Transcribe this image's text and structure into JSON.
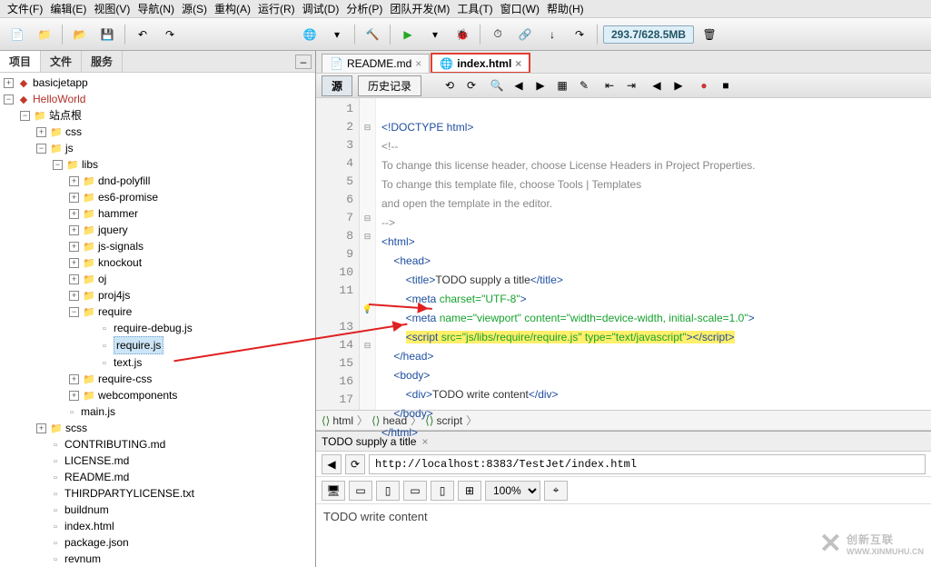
{
  "menu": [
    "文件(F)",
    "编辑(E)",
    "视图(V)",
    "导航(N)",
    "源(S)",
    "重构(A)",
    "运行(R)",
    "调试(D)",
    "分析(P)",
    "团队开发(M)",
    "工具(T)",
    "窗口(W)",
    "帮助(H)"
  ],
  "memory": "293.7/628.5MB",
  "leftTabs": {
    "project": "项目",
    "files": "文件",
    "services": "服务"
  },
  "tree": {
    "proj1": "basicjetapp",
    "proj2": "HelloWorld",
    "siteRoot": "站点根",
    "css": "css",
    "js": "js",
    "libs": "libs",
    "dnd": "dnd-polyfill",
    "es6": "es6-promise",
    "hammer": "hammer",
    "jquery": "jquery",
    "jssignals": "js-signals",
    "knockout": "knockout",
    "oj": "oj",
    "proj4js": "proj4js",
    "require": "require",
    "requiredebug": "require-debug.js",
    "requirejs": "require.js",
    "textjs": "text.js",
    "requirecss": "require-css",
    "webcomponents": "webcomponents",
    "mainjs": "main.js",
    "scss": "scss",
    "contributing": "CONTRIBUTING.md",
    "license": "LICENSE.md",
    "readme": "README.md",
    "thirdparty": "THIRDPARTYLICENSE.txt",
    "buildnum": "buildnum",
    "indexhtml": "index.html",
    "packagejson": "package.json",
    "revnum": "revnum"
  },
  "editorTabs": {
    "readme": "README.md",
    "index": "index.html"
  },
  "editorModes": {
    "source": "源",
    "history": "历史记录"
  },
  "code": {
    "l1": "<!DOCTYPE html>",
    "l2": "<!--",
    "l3": "To change this license header, choose License Headers in Project Properties.",
    "l4": "To change this template file, choose Tools | Templates",
    "l5": "and open the template in the editor.",
    "l6": "-->",
    "l7": "<html>",
    "l8": "    <head>",
    "l9a": "        <title>",
    "l9b": "TODO supply a title",
    "l9c": "</title>",
    "l10a": "        <meta ",
    "l10b": "charset=\"UTF-8\"",
    "l10c": ">",
    "l11a": "        <meta ",
    "l11b": "name=\"viewport\" content=\"width=device-width, initial-scale=1.0\"",
    "l11c": ">",
    "l12a": "        ",
    "l12b": "<script ",
    "l12c": "src=\"js/libs/require/require.js\" type=\"text/javascript\"",
    "l12d": ">",
    "l12e": "</",
    "l12f": "script>",
    "l13": "    </head>",
    "l14": "    <body>",
    "l15a": "        <div>",
    "l15b": "TODO write content",
    "l15c": "</div>",
    "l16": "    </body>",
    "l17": "</html>"
  },
  "breadcrumb": {
    "html": "html",
    "head": "head",
    "script": "script"
  },
  "preview": {
    "title": "TODO supply a title",
    "url": "http://localhost:8383/TestJet/index.html",
    "zoom": "100%",
    "body": "TODO write content"
  },
  "watermark": {
    "main": "创新互联",
    "sub": "WWW.XINMUHU.CN"
  }
}
